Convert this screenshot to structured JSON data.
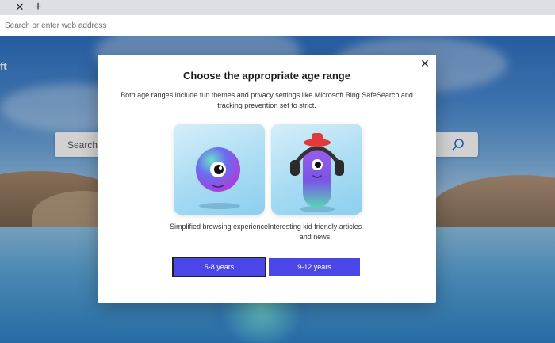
{
  "browser": {
    "tab_close_icon": "close-icon",
    "new_tab_icon": "plus-icon",
    "address_placeholder": "Search or enter web address"
  },
  "new_tab_page": {
    "brand_fragment": "ft",
    "search_label": "Search",
    "search_icon": "search-icon"
  },
  "dialog": {
    "title": "Choose the appropriate age range",
    "description": "Both age ranges include fun themes and privacy settings like Microsoft Bing SafeSearch and tracking prevention set to strict.",
    "close_icon": "close-icon",
    "options": [
      {
        "caption": "Simplified browsing experience",
        "button": "5-8 years",
        "selected": true
      },
      {
        "caption": "Interesting kid friendly articles and news",
        "button": "9-12 years",
        "selected": false
      }
    ],
    "accent_color": "#4a46e8"
  }
}
